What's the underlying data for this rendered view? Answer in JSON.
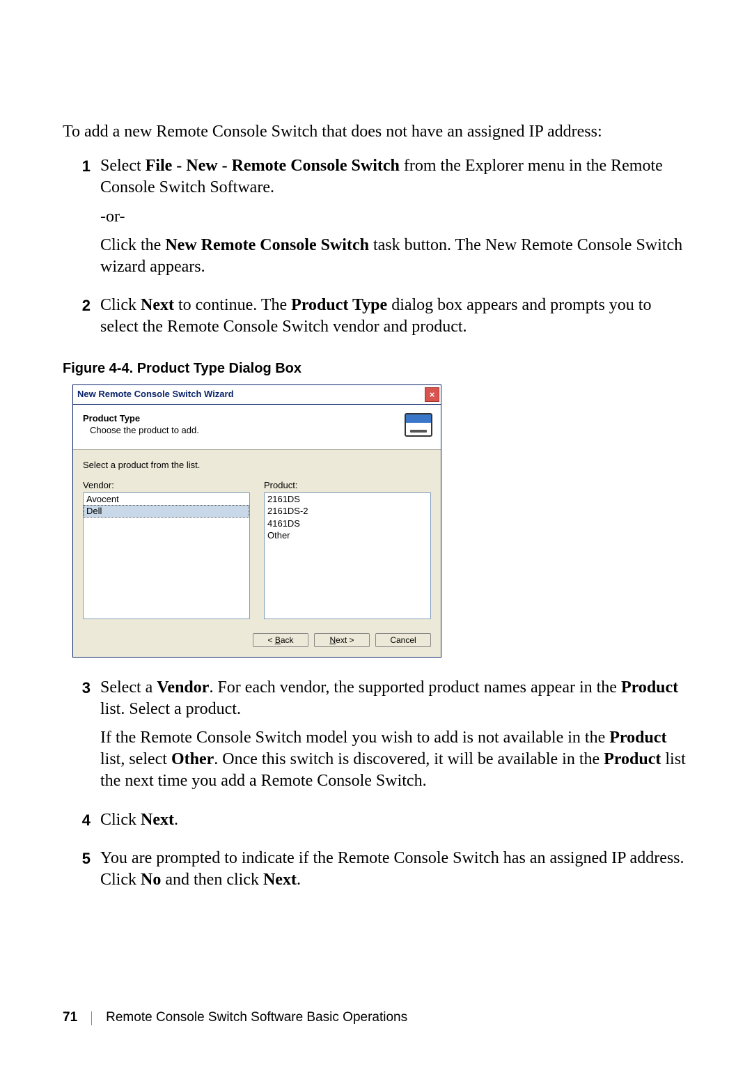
{
  "intro": "To add a new Remote Console Switch that does not have an assigned IP address:",
  "steps": {
    "s1": {
      "num": "1",
      "a1": "Select ",
      "a2": "File - New - Remote Console Switch",
      "a3": " from the Explorer menu in the Remote Console Switch Software.",
      "or": "-or-",
      "b1": "Click the ",
      "b2": "New Remote Console Switch",
      "b3": " task button. The New Remote Console Switch wizard appears."
    },
    "s2": {
      "num": "2",
      "a1": "Click ",
      "a2": "Next",
      "a3": " to continue. The ",
      "a4": "Product Type",
      "a5": " dialog box appears and prompts you to select the Remote Console Switch vendor and product."
    },
    "s3": {
      "num": "3",
      "a1": "Select a ",
      "a2": "Vendor",
      "a3": ". For each vendor, the supported product names appear in the ",
      "a4": "Product",
      "a5": " list. Select a product.",
      "b1": "If the Remote Console Switch model you wish to add is not available in the ",
      "b2": "Product",
      "b3": " list, select ",
      "b4": "Other",
      "b5": ". Once this switch is discovered, it will be available in the ",
      "b6": "Product",
      "b7": " list the next time you add a Remote Console Switch."
    },
    "s4": {
      "num": "4",
      "a1": "Click ",
      "a2": "Next",
      "a3": "."
    },
    "s5": {
      "num": "5",
      "a1": "You are prompted to indicate if the Remote Console Switch has an assigned IP address. Click ",
      "a2": "No",
      "a3": " and then click ",
      "a4": "Next",
      "a5": "."
    }
  },
  "figcap": "Figure 4-4.    Product Type Dialog Box",
  "dialog": {
    "title": "New Remote Console Switch Wizard",
    "header_title": "Product Type",
    "header_sub": "Choose the product to add.",
    "select_label": "Select a product from the list.",
    "vendor_label": "Vendor:",
    "product_label": "Product:",
    "vendors": [
      "Avocent",
      "Dell"
    ],
    "vendor_selected": 1,
    "products": [
      "2161DS",
      "2161DS-2",
      "4161DS",
      "Other"
    ],
    "back": "ack",
    "back_pre": "< ",
    "back_u": "B",
    "next": "ext >",
    "next_u": "N",
    "cancel": "Cancel"
  },
  "footer": {
    "page": "71",
    "chapter": "Remote Console Switch Software Basic Operations"
  }
}
